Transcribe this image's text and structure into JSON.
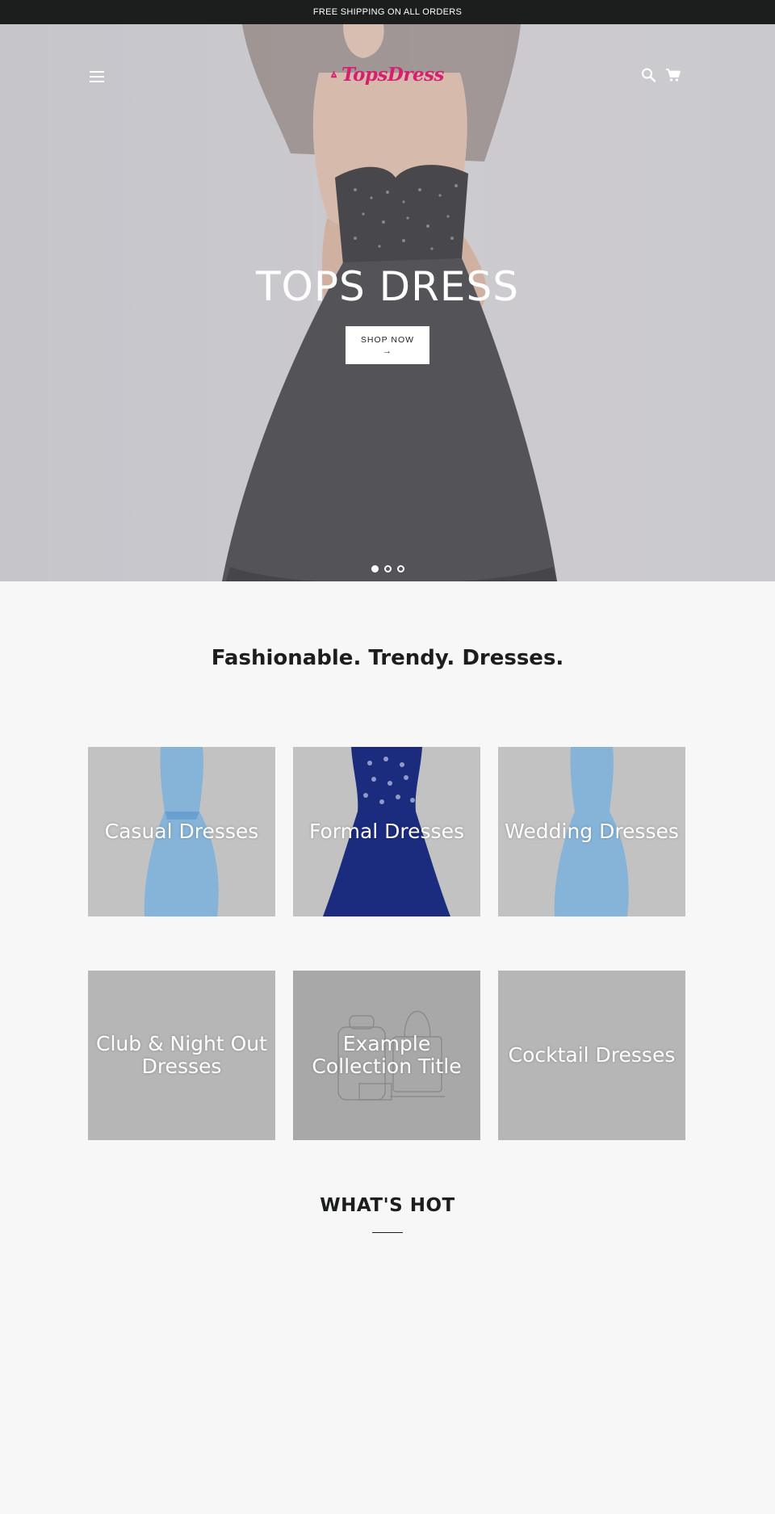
{
  "announcement": "FREE SHIPPING ON ALL ORDERS",
  "header": {
    "logo_text": "TopsDress",
    "icons": {
      "menu": "hamburger-menu-icon",
      "search": "search-icon",
      "cart": "cart-icon"
    },
    "brand_color": "#d61f6e"
  },
  "hero": {
    "title": "TOPS DRESS",
    "button_label": "SHOP NOW",
    "button_arrow": "→",
    "slides_count": 3,
    "active_slide": 1
  },
  "tagline": "Fashionable. Trendy. Dresses.",
  "collections": [
    {
      "title": "Casual Dresses"
    },
    {
      "title": "Formal Dresses"
    },
    {
      "title": "Wedding Dresses"
    },
    {
      "title": "Club & Night Out Dresses"
    },
    {
      "title": "Example Collection Title"
    },
    {
      "title": "Cocktail Dresses"
    }
  ],
  "featured": {
    "title": "WHAT'S HOT"
  }
}
